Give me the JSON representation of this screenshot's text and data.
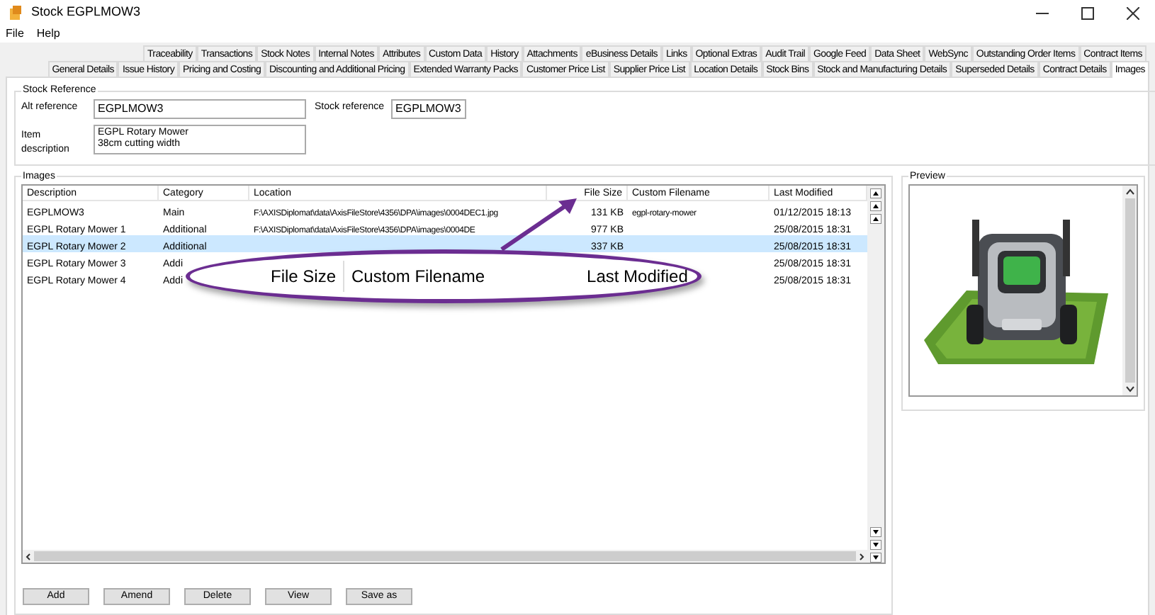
{
  "window": {
    "title": "Stock EGPLMOW3"
  },
  "menu": [
    "File",
    "Help"
  ],
  "tabs_row_1": [
    {
      "label": "Traceability",
      "selected": false
    },
    {
      "label": "Transactions",
      "selected": false
    },
    {
      "label": "Stock Notes",
      "selected": false
    },
    {
      "label": "Internal Notes",
      "selected": false
    },
    {
      "label": "Attributes",
      "selected": false
    },
    {
      "label": "Custom Data",
      "selected": false
    },
    {
      "label": "History",
      "selected": false
    },
    {
      "label": "Attachments",
      "selected": false
    },
    {
      "label": "eBusiness Details",
      "selected": false
    },
    {
      "label": "Links",
      "selected": false
    },
    {
      "label": "Optional Extras",
      "selected": false
    },
    {
      "label": "Audit Trail",
      "selected": false
    },
    {
      "label": "Google Feed",
      "selected": false
    },
    {
      "label": "Data Sheet",
      "selected": false
    },
    {
      "label": "WebSync",
      "selected": false
    },
    {
      "label": "Outstanding Order Items",
      "selected": false
    },
    {
      "label": "Contract Items",
      "selected": false
    }
  ],
  "tabs_row_2": [
    {
      "label": "General Details",
      "selected": false
    },
    {
      "label": "Issue History",
      "selected": false
    },
    {
      "label": "Pricing and Costing",
      "selected": false
    },
    {
      "label": "Discounting and Additional Pricing",
      "selected": false
    },
    {
      "label": "Extended Warranty Packs",
      "selected": false
    },
    {
      "label": "Customer Price List",
      "selected": false
    },
    {
      "label": "Supplier Price List",
      "selected": false
    },
    {
      "label": "Location Details",
      "selected": false
    },
    {
      "label": "Stock Bins",
      "selected": false
    },
    {
      "label": "Stock and Manufacturing Details",
      "selected": false
    },
    {
      "label": "Superseded Details",
      "selected": false
    },
    {
      "label": "Contract Details",
      "selected": false
    },
    {
      "label": "Images",
      "selected": true
    }
  ],
  "stock_reference": {
    "title": "Stock Reference",
    "alt_reference_label": "Alt reference",
    "alt_reference": "EGPLMOW3",
    "stock_reference_label": "Stock reference",
    "stock_reference": "EGPLMOW3",
    "item_description_label": "Item description",
    "item_description": [
      "EGPL Rotary Mower",
      "38cm cutting width"
    ]
  },
  "images": {
    "title": "Images",
    "columns": [
      "Description",
      "Category",
      "Location",
      "File Size",
      "Custom Filename",
      "Last Modified"
    ],
    "rows": [
      {
        "cells": [
          "EGPLMOW3",
          "Main",
          "F:\\AXISDiplomat\\data\\AxisFileStore\\4356\\DPA\\images\\0004DEC1.jpg",
          "131 KB",
          "egpl-rotary-mower",
          "01/12/2015 18:13"
        ],
        "selected": false
      },
      {
        "cells": [
          "EGPL Rotary Mower 1",
          "Additional",
          "F:\\AXISDiplomat\\data\\AxisFileStore\\4356\\DPA\\images\\0004DE",
          "977 KB",
          "",
          "25/08/2015 18:31"
        ],
        "selected": false
      },
      {
        "cells": [
          "EGPL Rotary Mower 2",
          "Additional",
          "",
          "337 KB",
          "",
          "25/08/2015 18:31"
        ],
        "selected": true
      },
      {
        "cells": [
          "EGPL Rotary Mower 3",
          "Addi",
          "",
          "",
          "",
          "25/08/2015 18:31"
        ],
        "selected": false
      },
      {
        "cells": [
          "EGPL Rotary Mower 4",
          "Addi",
          "",
          "",
          "",
          "25/08/2015 18:31"
        ],
        "selected": false
      }
    ],
    "buttons": [
      "Add",
      "Amend",
      "Delete",
      "View",
      "Save as"
    ]
  },
  "callout": {
    "labels": [
      "File Size",
      "Custom Filename",
      "Last Modified"
    ]
  },
  "preview": {
    "title": "Preview"
  }
}
